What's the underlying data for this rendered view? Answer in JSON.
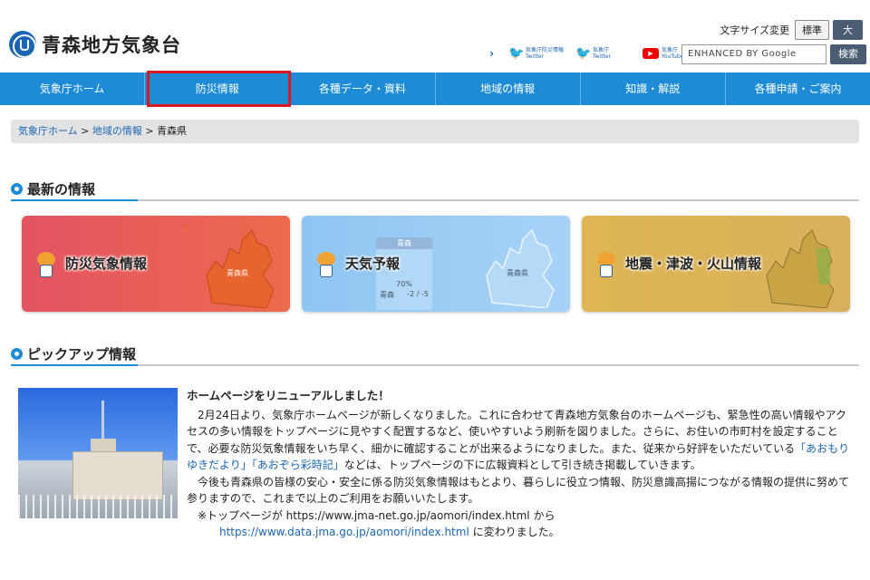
{
  "header": {
    "site_title": "青森地方気象台",
    "font_size_label": "文字サイズ変更",
    "font_size_standard": "標準",
    "font_size_large": "大",
    "sns_chevron": "›",
    "sns": [
      {
        "line1": "気象庁防災情報",
        "line2": "Twitter",
        "icon": "twitter-bird"
      },
      {
        "line1": "気象庁",
        "line2": "Twitter",
        "icon": "twitter-bird"
      },
      {
        "line1": "気象庁",
        "line2": "YouTube",
        "icon": "youtube-play"
      }
    ],
    "search_placeholder": "ENHANCED BY Google",
    "search_button": "検索"
  },
  "nav": {
    "items": [
      {
        "label": "気象庁ホーム"
      },
      {
        "label": "防災情報",
        "highlighted": true
      },
      {
        "label": "各種データ・資料"
      },
      {
        "label": "地域の情報"
      },
      {
        "label": "知識・解説"
      },
      {
        "label": "各種申請・ご案内"
      }
    ],
    "highlight_color": "#d9181f"
  },
  "breadcrumb": {
    "items": [
      "気象庁ホーム",
      "地域の情報"
    ],
    "separator": ">",
    "current": "青森県"
  },
  "latest": {
    "title": "最新の情報",
    "cards": [
      {
        "label": "防災気象情報",
        "map_label": "青森県",
        "color": "#e45463"
      },
      {
        "label": "天気予報",
        "map_label": "青森県",
        "color": "#8ec5f2",
        "panel_title": "青森",
        "panel_pop": "70%",
        "panel_city": "青森",
        "panel_temp": "-2 / -5"
      },
      {
        "label": "地震・津波・火山情報",
        "color": "#dfb652"
      }
    ]
  },
  "pickup": {
    "title": "ピックアップ情報",
    "heading": "ホームページをリニューアルしました！",
    "para1_a": "2月24日より、気象庁ホームページが新しくなりました。これに合わせて青森地方気象台のホームページも、緊急性の高い情報やアクセスの多い情報をトップページに見やすく配置するなど、使いやすいよう刷新を図りました。さらに、お住いの市町村を設定することで、必要な防災気象情報をいち早く、細かに確認することが出来るようになりました。また、従来から好評をいただいている",
    "link1": "「あおもりゆきだより」",
    "link2": "「あおぞら彩時記」",
    "para1_b": "などは、トップページの下に広報資料として引き続き掲載していきます。",
    "para2": "今後も青森県の皆様の安心・安全に係る防災気象情報はもとより、暮らしに役立つ情報、防災意識高揚につながる情報の提供に努めて参りますので、これまで以上のご利用をお願いいたします。",
    "note_prefix": "※トップページが",
    "old_url": "https://www.jma-net.go.jp/aomori/index.html",
    "note_mid": "から",
    "new_url": "https://www.data.jma.go.jp/aomori/index.html",
    "note_suffix": "に変わりました。"
  }
}
